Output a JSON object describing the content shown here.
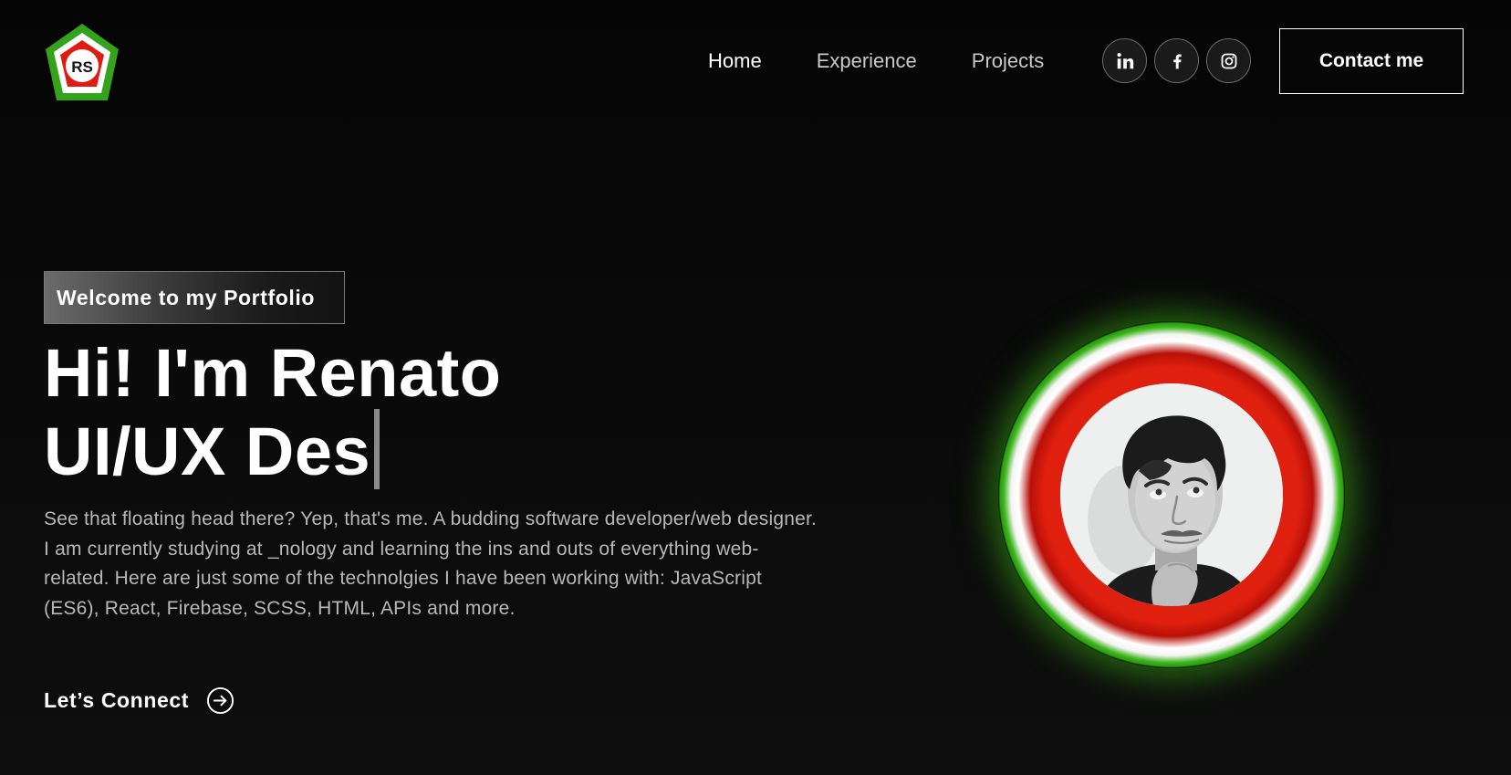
{
  "logo": {
    "initials": "RS",
    "colors": {
      "outer": "#34a31b",
      "middle": "#ffffff",
      "inner": "#e01b12"
    }
  },
  "nav": {
    "links": [
      {
        "label": "Home",
        "active": true
      },
      {
        "label": "Experience",
        "active": false
      },
      {
        "label": "Projects",
        "active": false
      }
    ],
    "social": [
      {
        "icon": "linkedin-icon"
      },
      {
        "icon": "facebook-icon"
      },
      {
        "icon": "instagram-icon"
      }
    ],
    "contact_label": "Contact me"
  },
  "hero": {
    "tagline": "Welcome to my Portfolio",
    "headline_line1": "Hi! I'm Renato",
    "headline_line2": "UI/UX Des",
    "description": "See that floating head there? Yep, that's me. A budding software developer/web designer. I am currently studying at _nology and learning the ins and outs of everything web-related. Here are just some of the technolgies I have been working with: JavaScript (ES6), React, Firebase, SCSS, HTML, APIs and more.",
    "connect_label": "Let’s Connect",
    "connect_icon": "arrow-right-circle-icon"
  },
  "avatar": {
    "ring_colors": {
      "outer_glow": "#3cb51a",
      "white": "#ffffff",
      "red": "#e0200f"
    }
  },
  "theme": {
    "background": "#0a0a0a",
    "text": "#ffffff",
    "muted_text": "#b8b8b8"
  }
}
